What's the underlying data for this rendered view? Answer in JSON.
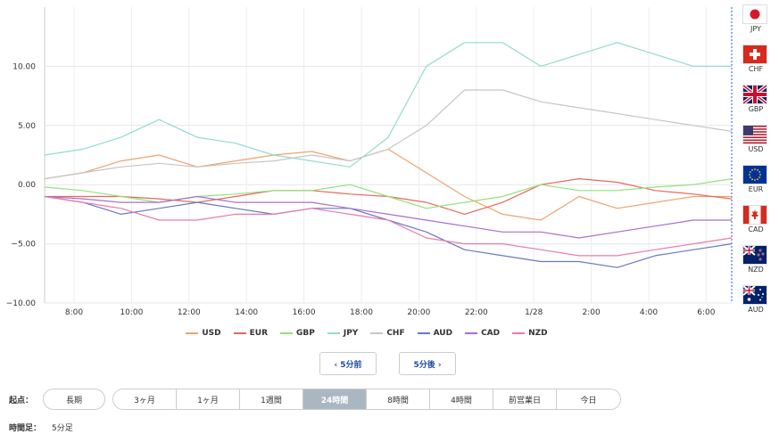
{
  "chart_data": {
    "type": "line",
    "x_labels": [
      "8:00",
      "10:00",
      "12:00",
      "14:00",
      "16:00",
      "18:00",
      "20:00",
      "22:00",
      "1/28",
      "2:00",
      "4:00",
      "6:00"
    ],
    "y_ticks": [
      "10.00",
      "5.00",
      "0.00",
      "−5.00",
      "−10.00"
    ],
    "ylim": [
      -10,
      15
    ],
    "series": [
      {
        "name": "USD",
        "color": "#f0a36d",
        "values": [
          0.5,
          1,
          2,
          2.5,
          1.5,
          2,
          2.5,
          2.8,
          2,
          3,
          1,
          -1,
          -2.5,
          -3,
          -1,
          -2,
          -1.5,
          -1,
          -1
        ]
      },
      {
        "name": "EUR",
        "color": "#e8685a",
        "values": [
          -1,
          -1,
          -1,
          -1.2,
          -1.5,
          -1,
          -0.5,
          -0.5,
          -0.8,
          -1,
          -1.5,
          -2.5,
          -1.5,
          0,
          0.5,
          0.2,
          -0.5,
          -0.8,
          -1.2
        ]
      },
      {
        "name": "GBP",
        "color": "#8fe37a",
        "values": [
          -0.2,
          -0.5,
          -1,
          -1.5,
          -1,
          -0.8,
          -0.5,
          -0.5,
          0,
          -1,
          -2,
          -1.5,
          -1,
          0,
          -0.5,
          -0.5,
          -0.2,
          0,
          0.5
        ]
      },
      {
        "name": "JPY",
        "color": "#8fdcd0",
        "values": [
          2.5,
          3,
          4,
          5.5,
          4,
          3.5,
          2.5,
          2,
          1.5,
          4,
          10,
          12,
          12,
          10,
          11,
          12,
          11,
          10,
          10
        ]
      },
      {
        "name": "CHF",
        "color": "#c5c5c5",
        "values": [
          0.5,
          1,
          1.5,
          1.8,
          1.5,
          1.8,
          2,
          2.5,
          2,
          3,
          5,
          8,
          8,
          7,
          6.5,
          6,
          5.5,
          5,
          4.5
        ]
      },
      {
        "name": "AUD",
        "color": "#6878c7",
        "values": [
          -1,
          -1.5,
          -2.5,
          -2,
          -1.5,
          -2,
          -2.5,
          -2,
          -2,
          -3,
          -4,
          -5.5,
          -6,
          -6.5,
          -6.5,
          -7,
          -6,
          -5.5,
          -5
        ]
      },
      {
        "name": "CAD",
        "color": "#a86fce",
        "values": [
          -1,
          -1.2,
          -1.5,
          -1.5,
          -1,
          -1.5,
          -1.5,
          -1.5,
          -2,
          -2.5,
          -3,
          -3.5,
          -4,
          -4,
          -4.5,
          -4,
          -3.5,
          -3,
          -3
        ]
      },
      {
        "name": "NZD",
        "color": "#ec79ac",
        "values": [
          -1,
          -1.5,
          -2,
          -3,
          -3,
          -2.5,
          -2.5,
          -2,
          -2.5,
          -3,
          -4.5,
          -5,
          -5,
          -5.5,
          -6,
          -6,
          -5.5,
          -5,
          -4.5
        ]
      }
    ]
  },
  "flags": [
    {
      "code": "JPY",
      "icon": "japan-flag-icon"
    },
    {
      "code": "CHF",
      "icon": "switzerland-flag-icon"
    },
    {
      "code": "GBP",
      "icon": "uk-flag-icon"
    },
    {
      "code": "USD",
      "icon": "usa-flag-icon"
    },
    {
      "code": "EUR",
      "icon": "eu-flag-icon"
    },
    {
      "code": "CAD",
      "icon": "canada-flag-icon"
    },
    {
      "code": "NZD",
      "icon": "new-zealand-flag-icon"
    },
    {
      "code": "AUD",
      "icon": "australia-flag-icon"
    }
  ],
  "nav": {
    "prev_label": "‹ 5分前",
    "next_label": "5分後 ›"
  },
  "start": {
    "label": "起点：",
    "button": "長期"
  },
  "periods": [
    {
      "label": "3ヶ月",
      "active": false
    },
    {
      "label": "1ヶ月",
      "active": false
    },
    {
      "label": "1週間",
      "active": false
    },
    {
      "label": "24時間",
      "active": true
    },
    {
      "label": "8時間",
      "active": false
    },
    {
      "label": "4時間",
      "active": false
    },
    {
      "label": "前営業日",
      "active": false
    },
    {
      "label": "今日",
      "active": false
    }
  ],
  "footer": {
    "label": "時間足：",
    "value": "5分足"
  }
}
